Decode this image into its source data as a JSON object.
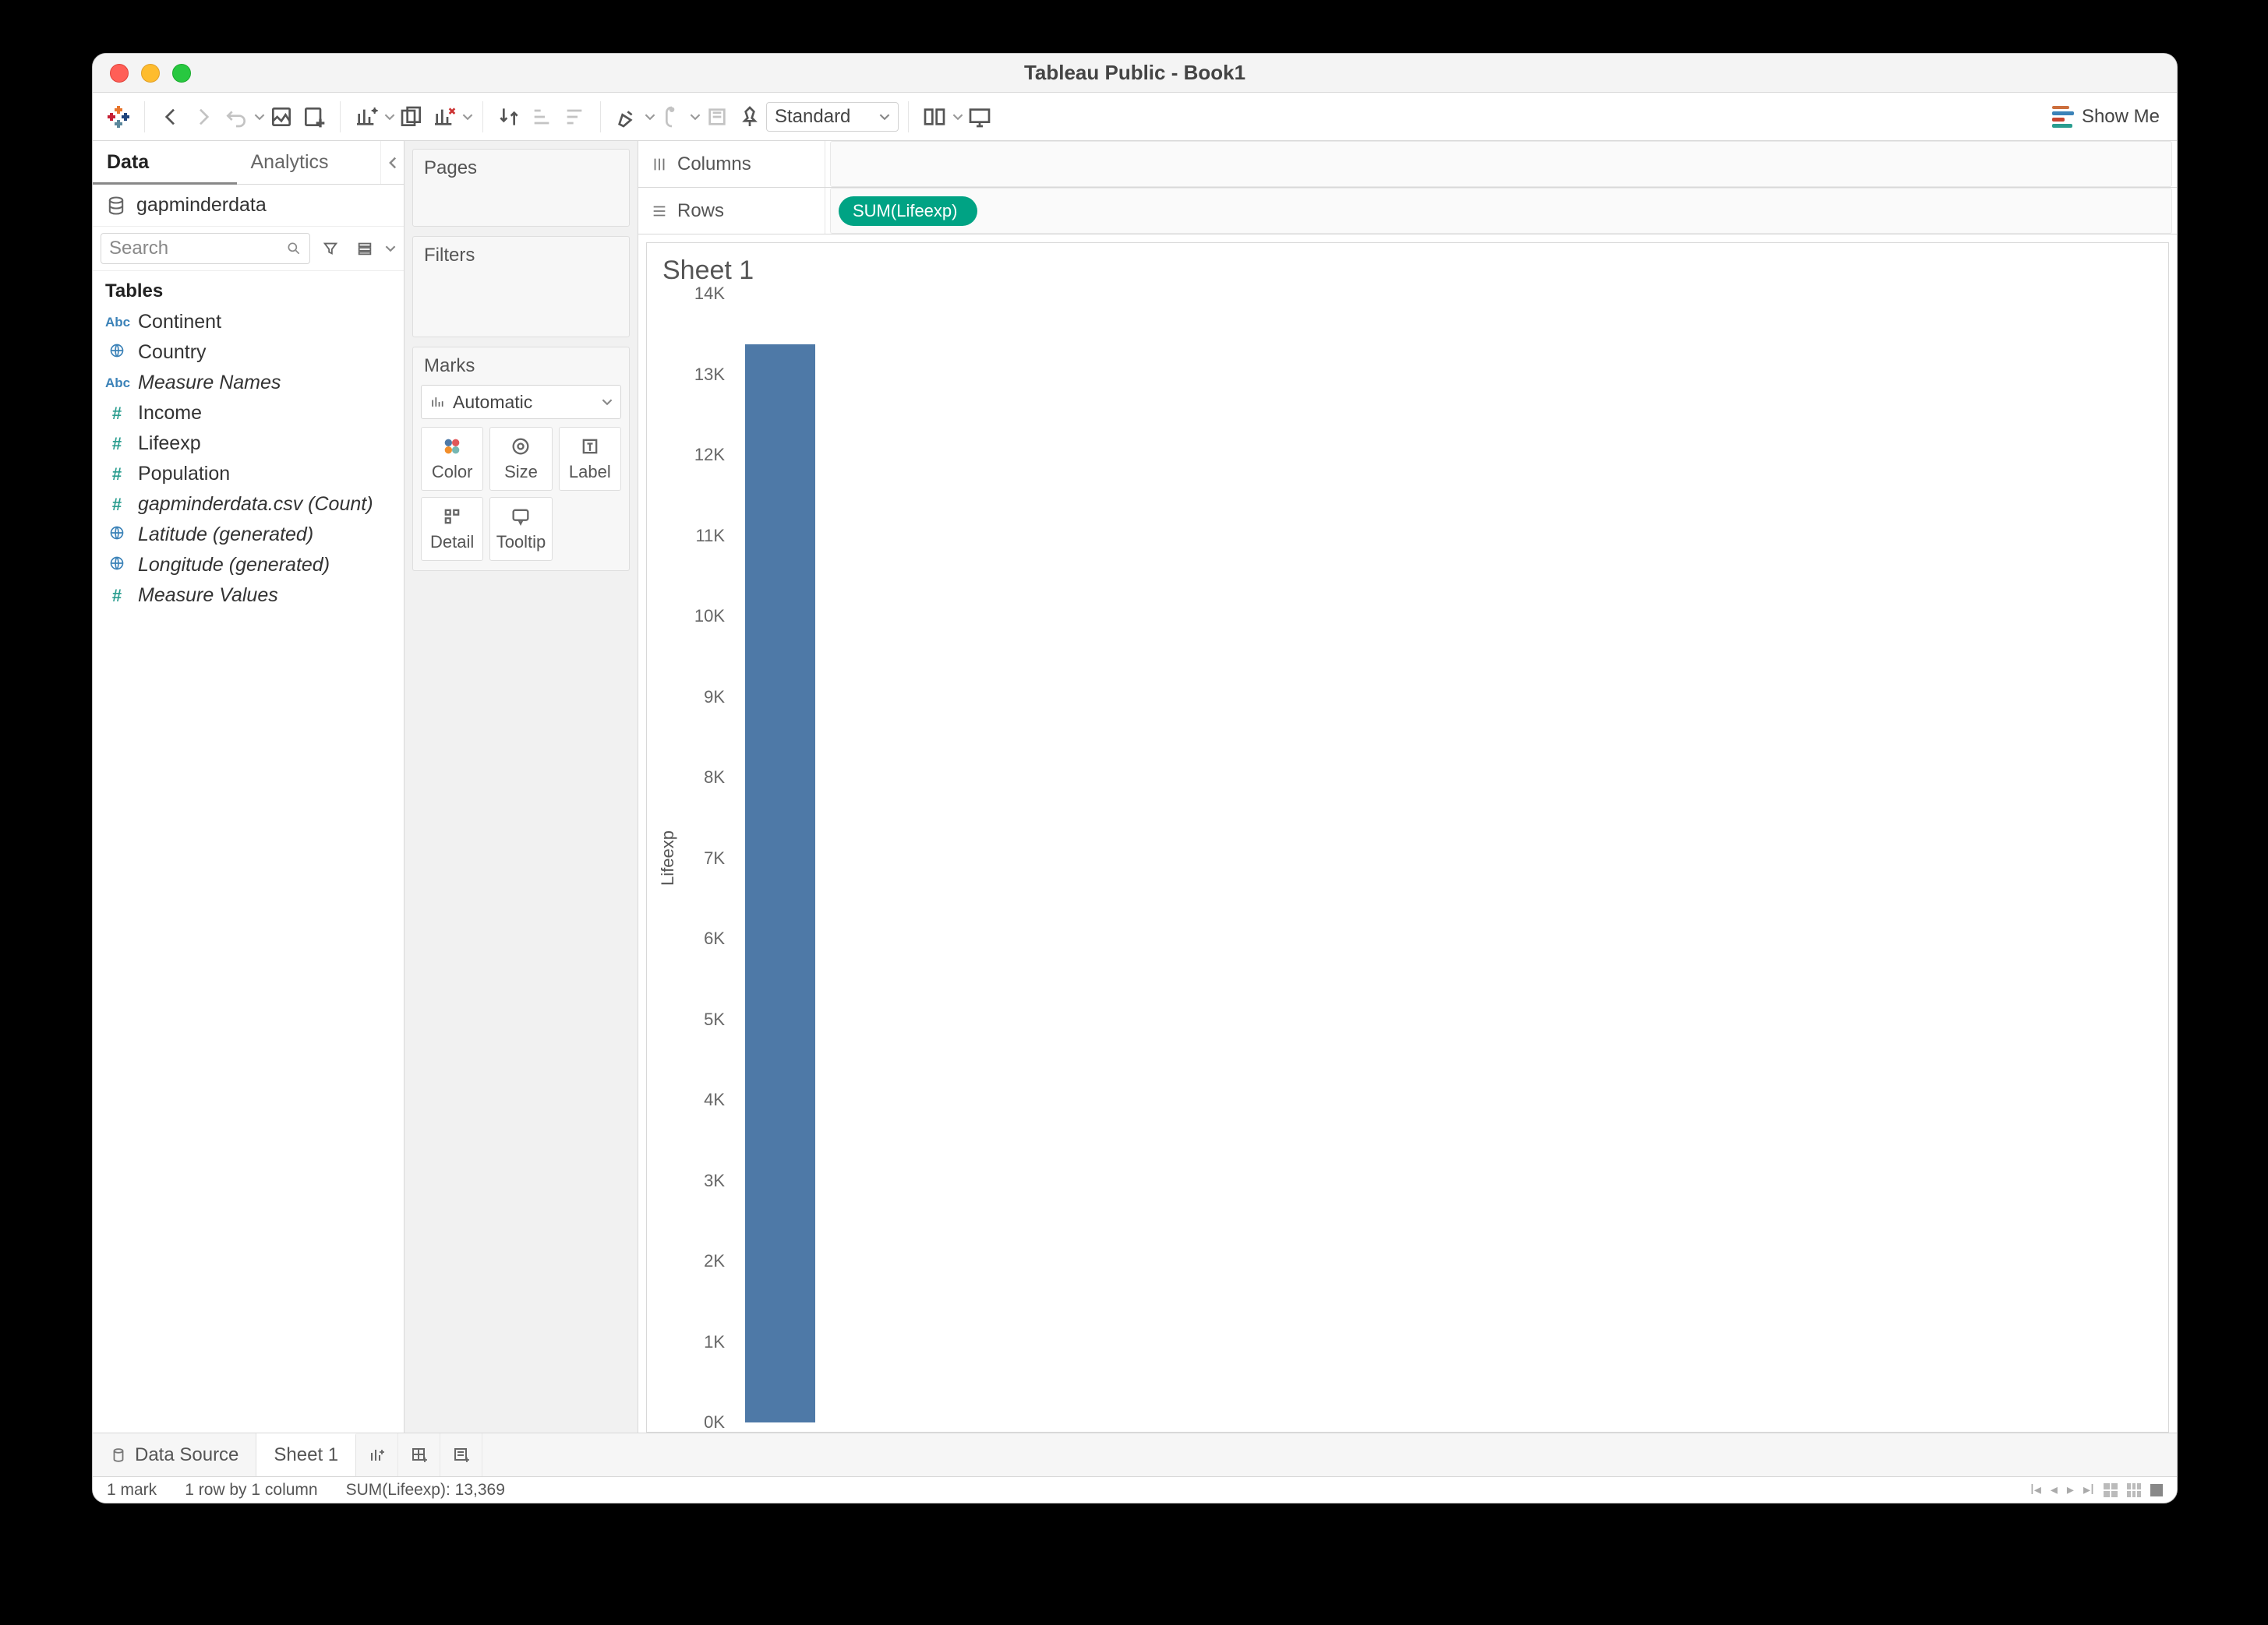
{
  "window": {
    "title": "Tableau Public - Book1"
  },
  "toolbar": {
    "fit_label": "Standard",
    "showme_label": "Show Me"
  },
  "sidebar": {
    "tabs": {
      "data": "Data",
      "analytics": "Analytics"
    },
    "datasource": "gapminderdata",
    "search_placeholder": "Search",
    "tables_header": "Tables",
    "fields": [
      {
        "icon": "abc",
        "label": "Continent",
        "italic": false
      },
      {
        "icon": "globe",
        "label": "Country",
        "italic": false
      },
      {
        "icon": "abc",
        "label": "Measure Names",
        "italic": true
      },
      {
        "icon": "hash",
        "label": "Income",
        "italic": false
      },
      {
        "icon": "hash",
        "label": "Lifeexp",
        "italic": false
      },
      {
        "icon": "hash",
        "label": "Population",
        "italic": false
      },
      {
        "icon": "hash",
        "label": "gapminderdata.csv (Count)",
        "italic": true
      },
      {
        "icon": "globe",
        "label": "Latitude (generated)",
        "italic": true
      },
      {
        "icon": "globe",
        "label": "Longitude (generated)",
        "italic": true
      },
      {
        "icon": "hash",
        "label": "Measure Values",
        "italic": true
      }
    ]
  },
  "cards": {
    "pages": "Pages",
    "filters": "Filters",
    "marks": "Marks",
    "mark_type": "Automatic",
    "cells": {
      "color": "Color",
      "size": "Size",
      "label": "Label",
      "detail": "Detail",
      "tooltip": "Tooltip"
    }
  },
  "shelves": {
    "columns": "Columns",
    "rows": "Rows",
    "row_pill": "SUM(Lifeexp)"
  },
  "viz": {
    "title": "Sheet 1",
    "ylabel": "Lifeexp",
    "yticks": [
      "14K",
      "13K",
      "12K",
      "11K",
      "10K",
      "9K",
      "8K",
      "7K",
      "6K",
      "5K",
      "4K",
      "3K",
      "2K",
      "1K",
      "0K"
    ]
  },
  "tabs": {
    "data_source": "Data Source",
    "sheet1": "Sheet 1"
  },
  "status": {
    "marks": "1 mark",
    "dim": "1 row by 1 column",
    "sum": "SUM(Lifeexp): 13,369"
  },
  "chart_data": {
    "type": "bar",
    "categories": [
      ""
    ],
    "values": [
      13369
    ],
    "title": "Sheet 1",
    "xlabel": "",
    "ylabel": "Lifeexp",
    "ylim": [
      0,
      14000
    ]
  }
}
